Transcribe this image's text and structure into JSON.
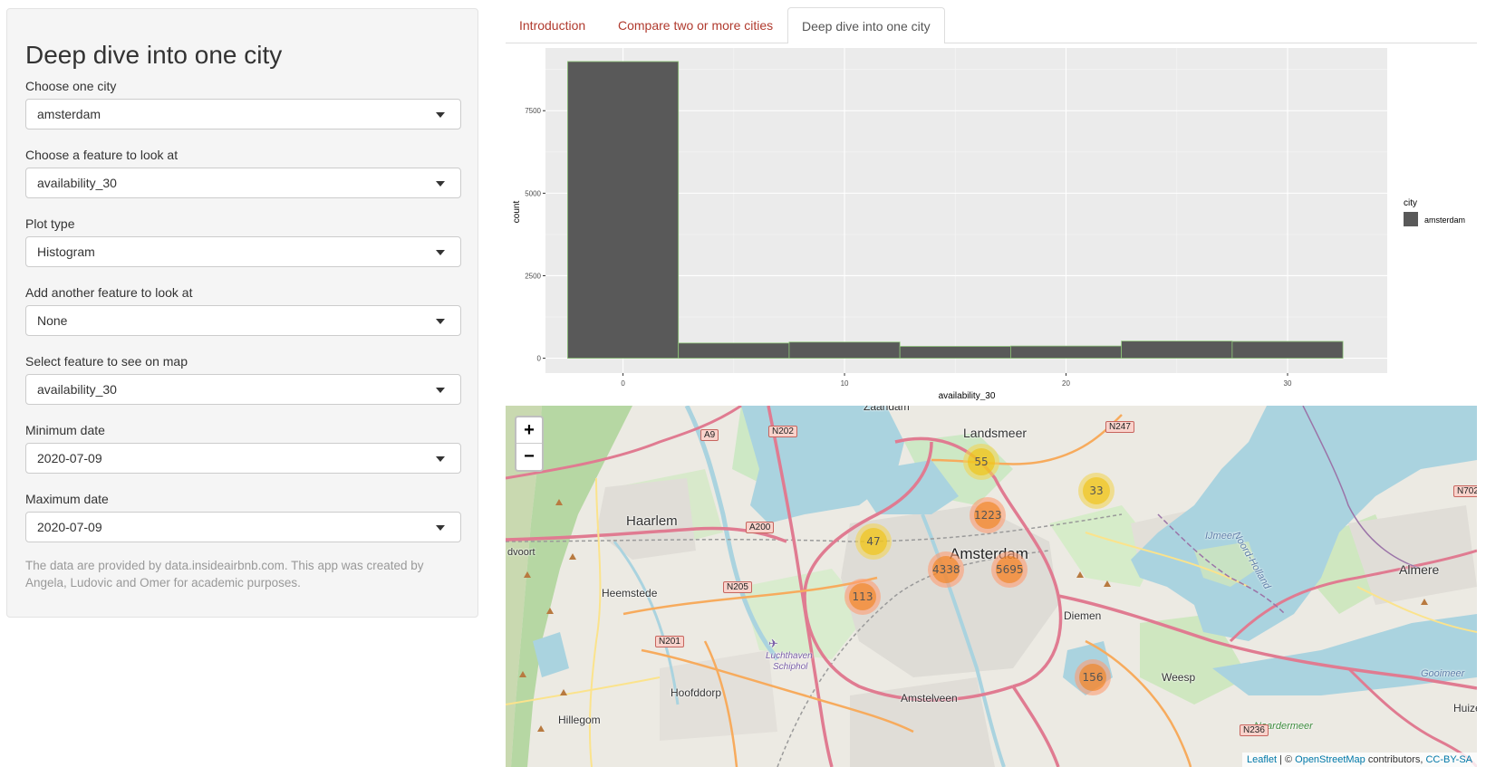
{
  "sidebar": {
    "title": "Deep dive into one city",
    "fields": [
      {
        "label": "Choose one city",
        "value": "amsterdam"
      },
      {
        "label": "Choose a feature to look at",
        "value": "availability_30"
      },
      {
        "label": "Plot type",
        "value": "Histogram"
      },
      {
        "label": "Add another feature to look at",
        "value": "None"
      },
      {
        "label": "Select feature to see on map",
        "value": "availability_30"
      },
      {
        "label": "Minimum date",
        "value": "2020-07-09"
      },
      {
        "label": "Maximum date",
        "value": "2020-07-09"
      }
    ],
    "note": "The data are provided by data.insideairbnb.com. This app was created by Angela, Ludovic and Omer for academic purposes."
  },
  "tabs": [
    {
      "label": "Introduction",
      "active": false
    },
    {
      "label": "Compare two or more cities",
      "active": false
    },
    {
      "label": "Deep dive into one city",
      "active": true
    }
  ],
  "chart_data": {
    "type": "bar",
    "xlabel": "availability_30",
    "ylabel": "count",
    "x_ticks": [
      0,
      10,
      20,
      30
    ],
    "y_ticks": [
      0,
      2500,
      5000,
      7500
    ],
    "xlim": [
      -3.5,
      34.5
    ],
    "ylim": [
      -450,
      9400
    ],
    "bin_width": 5,
    "bin_centers": [
      0,
      5,
      10,
      15,
      20,
      25,
      30
    ],
    "values": [
      8990,
      460,
      490,
      360,
      370,
      520,
      510
    ],
    "legend_title": "city",
    "series": [
      {
        "name": "amsterdam",
        "color": "#595959"
      }
    ],
    "fill_color": "#595959",
    "outline_color": "#8fc77a",
    "grid": true
  },
  "map": {
    "zoom_in": "+",
    "zoom_out": "−",
    "clusters": [
      {
        "count": "55",
        "size": "medium"
      },
      {
        "count": "33",
        "size": "medium"
      },
      {
        "count": "1223",
        "size": "large"
      },
      {
        "count": "47",
        "size": "medium"
      },
      {
        "count": "4338",
        "size": "large"
      },
      {
        "count": "5695",
        "size": "large"
      },
      {
        "count": "113",
        "size": "large"
      },
      {
        "count": "156",
        "size": "large"
      }
    ],
    "places": {
      "zaandam": "Zaandam",
      "landsmeer": "Landsmeer",
      "haarlem": "Haarlem",
      "amsterdam": "Amsterdam",
      "heemstede": "Heemstede",
      "almere": "Almere",
      "diemen": "Diemen",
      "hoofddorp": "Hoofddorp",
      "amstelveen": "Amstelveen",
      "weesp": "Weesp",
      "hillegom": "Hillegom",
      "ijmeer": "IJmeer",
      "noord_holland": "Noord-Holland",
      "luchthaven": "Luchthaven",
      "schiphol": "Schiphol",
      "dvoort": "dvoort",
      "naardermeer": "Naardermeer",
      "gooimeer": "Gooimeer",
      "huizen": "Huize"
    },
    "roads": {
      "a9": "A9",
      "n202": "N202",
      "n247": "N247",
      "a200": "A200",
      "n205": "N205",
      "n201": "N201",
      "n236": "N236",
      "n702": "N702"
    },
    "attribution": {
      "leaflet": "Leaflet",
      "sep": " | © ",
      "osm": "OpenStreetMap",
      "contrib": " contributors, ",
      "license": "CC-BY-SA"
    }
  }
}
